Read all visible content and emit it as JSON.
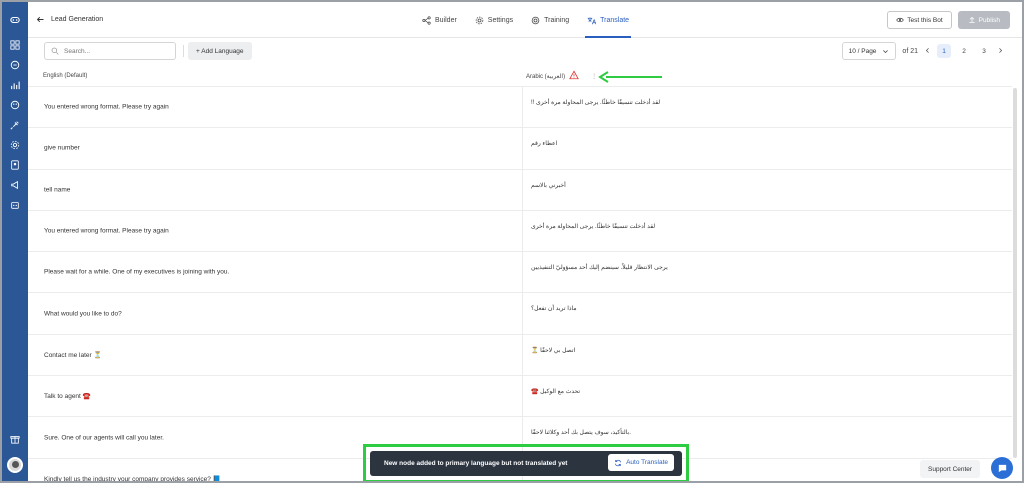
{
  "header": {
    "back_title": "Lead Generation",
    "tabs": [
      {
        "label": "Builder",
        "icon": "flow-icon"
      },
      {
        "label": "Settings",
        "icon": "gear-icon"
      },
      {
        "label": "Training",
        "icon": "target-icon"
      },
      {
        "label": "Translate",
        "icon": "translate-icon",
        "active": true
      }
    ],
    "test_bot_label": "Test this Bot",
    "publish_label": "Publish"
  },
  "toolbar": {
    "search_placeholder": "Search...",
    "add_language_label": "+ Add Language",
    "per_page": "10 / Page",
    "of_total": "of 21",
    "pages": [
      "1",
      "2",
      "3"
    ],
    "current_page": "1"
  },
  "table": {
    "col_english": "English (Default)",
    "col_arabic": "Arabic (العربية)",
    "rows": [
      {
        "en": "You entered wrong format. Please try again",
        "ar": "!! لقد أدخلت تنسيقًا خاطئًا. يرجى المحاولة مرة أخرى"
      },
      {
        "en": "give number",
        "ar": "اعطاء رقم"
      },
      {
        "en": "tell name",
        "ar": "أخبرني بالاسم"
      },
      {
        "en": "You entered wrong format. Please try again",
        "ar": "لقد أدخلت تنسيقًا خاطئًا. يرجى المحاولة مرة أخرى"
      },
      {
        "en": "Please wait for a while. One of my executives is joining with you.",
        "ar": "يرجى الانتظار قليلاً. سينضم إليك أحد مسؤوليّ التنفيذيين"
      },
      {
        "en": "What would you like to do?",
        "ar": "ماذا تريد أن تفعل؟"
      },
      {
        "en": "Contact me later ⏳",
        "ar": "⏳ اتصل بي لاحقًا"
      },
      {
        "en": "Talk to agent ☎️",
        "ar": "☎️ تحدث مع الوكيل"
      },
      {
        "en": "Sure. One of our agents will call you later.",
        "ar": "بالتأكيد، سوف يتصل بك أحد وكلائنا لاحقًا."
      },
      {
        "en": "Kindly tell us the industry your company provides service? 📘",
        "ar": ""
      }
    ]
  },
  "toast": {
    "message": "New node added to primary language but not translated yet",
    "button_label": "Auto Translate"
  },
  "support_label": "Support Center",
  "colors": {
    "sidebar": "#2b5797",
    "accent": "#2b5fbf",
    "toast_bg": "#2c3440",
    "highlight_green": "#2ecc40",
    "warning_red": "#e03b3b"
  }
}
